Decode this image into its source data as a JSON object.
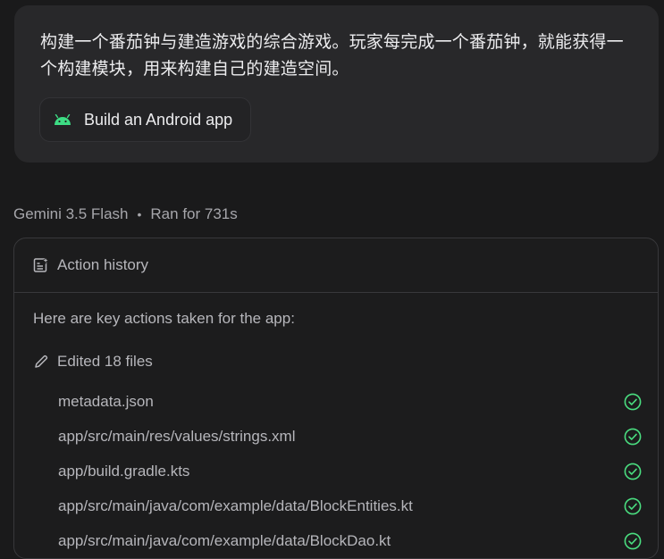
{
  "prompt": {
    "text": "构建一个番茄钟与建造游戏的综合游戏。玩家每完成一个番茄钟，就能获得一个构建模块，用来构建自己的建造空间。",
    "chip_label": "Build an Android app",
    "chip_icon": "android-icon",
    "chip_icon_color": "#3ddc84"
  },
  "meta": {
    "model": "Gemini 3.5 Flash",
    "separator": "•",
    "run_time": "Ran for 731s"
  },
  "history": {
    "title": "Action history",
    "title_icon": "action-history-icon",
    "intro": "Here are key actions taken for the app:",
    "edited_label": "Edited 18 files",
    "edited_icon": "pencil-icon",
    "check_color": "#4ade80",
    "files": [
      {
        "name": "metadata.json",
        "status": "done"
      },
      {
        "name": "app/src/main/res/values/strings.xml",
        "status": "done"
      },
      {
        "name": "app/build.gradle.kts",
        "status": "done"
      },
      {
        "name": "app/src/main/java/com/example/data/BlockEntities.kt",
        "status": "done"
      },
      {
        "name": "app/src/main/java/com/example/data/BlockDao.kt",
        "status": "done"
      }
    ]
  }
}
